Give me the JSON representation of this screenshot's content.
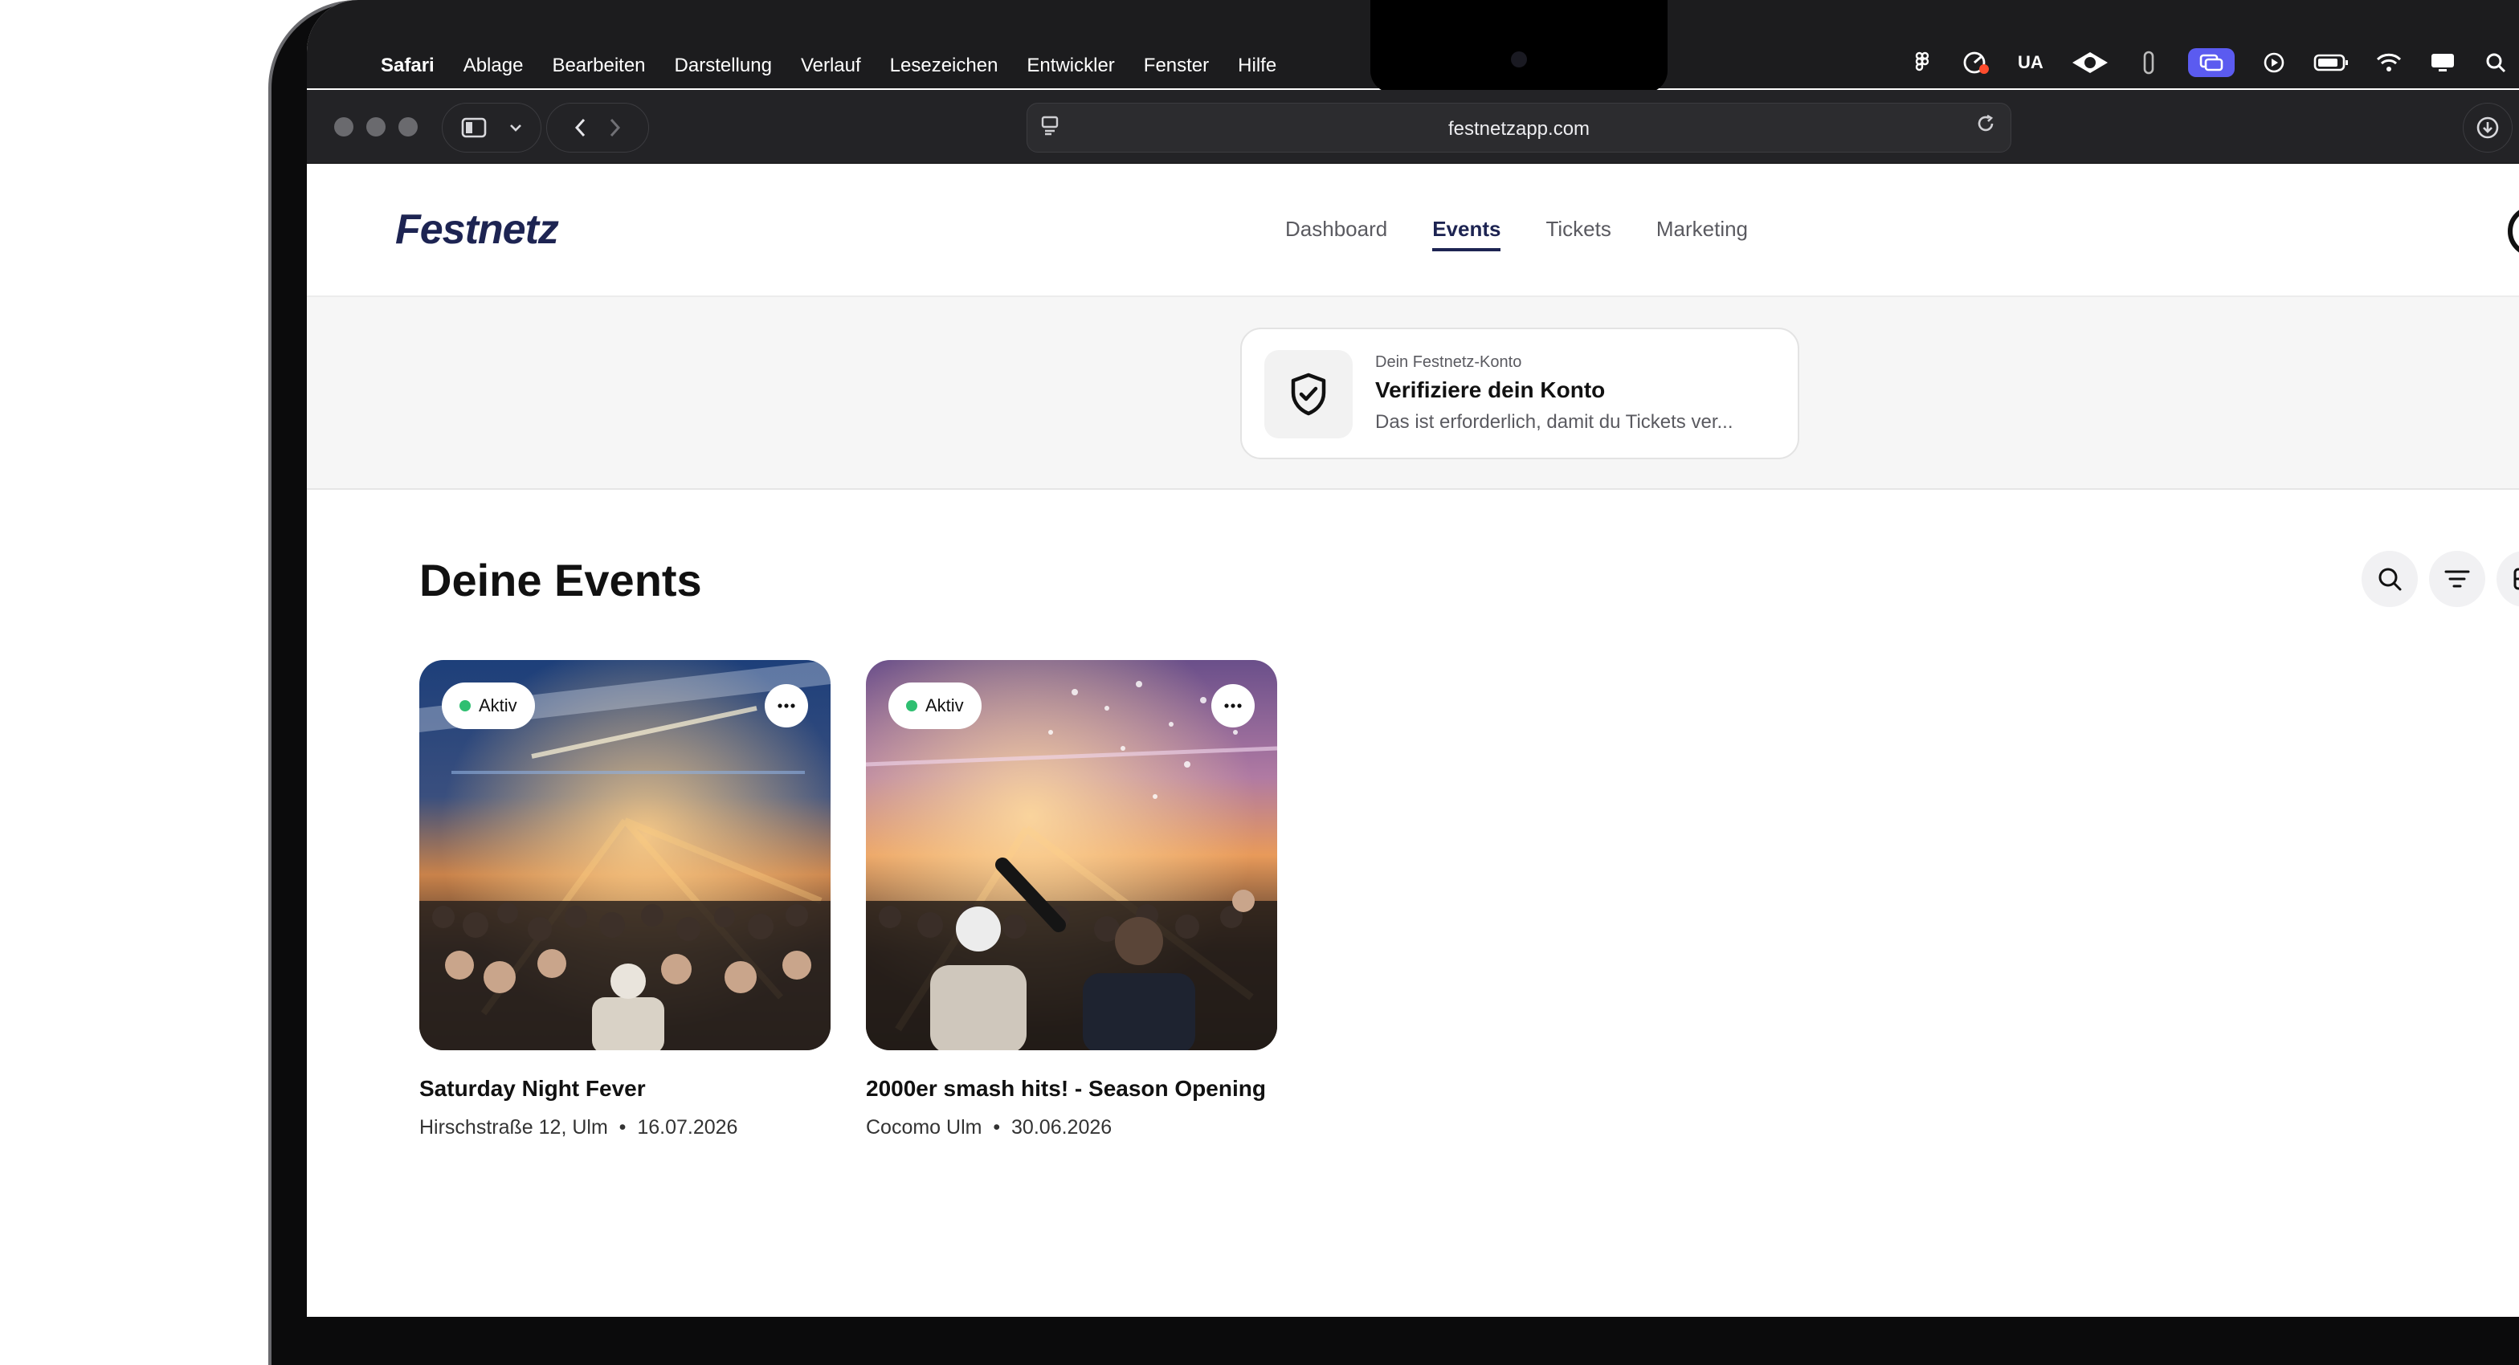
{
  "menubar": {
    "app_name": "Safari",
    "items": [
      "Ablage",
      "Bearbeiten",
      "Darstellung",
      "Verlauf",
      "Lesezeichen",
      "Entwickler",
      "Fenster",
      "Hilfe"
    ],
    "tray_text": "UA"
  },
  "browser": {
    "url": "festnetzapp.com"
  },
  "app": {
    "logo": "Festnetz",
    "nav": [
      "Dashboard",
      "Events",
      "Tickets",
      "Marketing"
    ],
    "active_nav": "Events"
  },
  "verify": {
    "kicker": "Dein Festnetz-Konto",
    "title": "Verifiziere dein Konto",
    "subtitle": "Das ist erforderlich, damit du Tickets ver..."
  },
  "events_section": {
    "title": "Deine Events",
    "events": [
      {
        "status": "Aktiv",
        "name": "Saturday Night Fever",
        "location": "Hirschstraße 12, Ulm",
        "date": "16.07.2026"
      },
      {
        "status": "Aktiv",
        "name": "2000er smash hits! - Season Opening",
        "location": "Cocomo Ulm",
        "date": "30.06.2026"
      }
    ]
  },
  "colors": {
    "brand": "#1d2452",
    "active": "#2fbf71"
  }
}
